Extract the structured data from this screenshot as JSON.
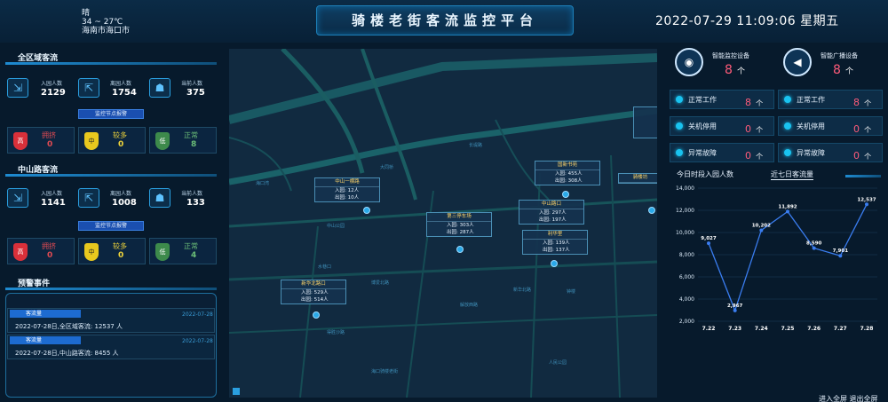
{
  "header": {
    "weather": "晴",
    "temperature": "34 ~ 27℃",
    "location": "海南市海口市",
    "title": "骑楼老街客流监控平台",
    "datetime": "2022-07-29  11:09:06  星期五"
  },
  "area_all": {
    "title": "全区域客流",
    "stats": [
      {
        "label": "入园人数",
        "value": "2129",
        "icon": "enter-icon"
      },
      {
        "label": "离园人数",
        "value": "1754",
        "icon": "exit-icon"
      },
      {
        "label": "当前人数",
        "value": "375",
        "icon": "people-icon"
      }
    ],
    "monitor_label": "监控节点报警",
    "levels": [
      {
        "badge": "高",
        "name": "拥挤",
        "value": "0",
        "color": "#d9303a"
      },
      {
        "badge": "中",
        "name": "较多",
        "value": "0",
        "color": "#e8c81e"
      },
      {
        "badge": "低",
        "name": "正常",
        "value": "8",
        "color": "#3d8a4b"
      }
    ]
  },
  "area_zs": {
    "title": "中山路客流",
    "stats": [
      {
        "label": "入园人数",
        "value": "1141",
        "icon": "enter-icon"
      },
      {
        "label": "离园人数",
        "value": "1008",
        "icon": "exit-icon"
      },
      {
        "label": "当前人数",
        "value": "133",
        "icon": "people-icon"
      }
    ],
    "monitor_label": "监控节点报警",
    "levels": [
      {
        "badge": "高",
        "name": "拥挤",
        "value": "0",
        "color": "#d9303a"
      },
      {
        "badge": "中",
        "name": "较多",
        "value": "0",
        "color": "#e8c81e"
      },
      {
        "badge": "低",
        "name": "正常",
        "value": "4",
        "color": "#3d8a4b"
      }
    ]
  },
  "alerts": {
    "title": "预警事件",
    "items": [
      {
        "tag": "客流量",
        "date": "2022-07-28",
        "text": "2022-07-28日,全区域客流: 12537 人"
      },
      {
        "tag": "客流量",
        "date": "2022-07-28",
        "text": "2022-07-28日,中山路客流: 8455 人"
      }
    ]
  },
  "map": {
    "callouts": [
      {
        "name": "中山一横路",
        "in": "入园: 12人",
        "out": "出园: 10人"
      },
      {
        "name": "第三停车场",
        "in": "入园: 303人",
        "out": "出园: 287人"
      },
      {
        "name": "新华北路口",
        "in": "入园: 529人",
        "out": "出园: 514人"
      },
      {
        "name": "国新书苑",
        "in": "入园: 455人",
        "out": "出园: 308人"
      },
      {
        "name": "中山路口",
        "in": "入园: 297人",
        "out": "出园: 197人"
      },
      {
        "name": "利华里",
        "in": "入园: 139人",
        "out": "出园: 137人"
      },
      {
        "name": "骑楼坊",
        "in": "",
        "out": ""
      }
    ],
    "labels": [
      "长堤路",
      "大同桥",
      "海口湾",
      "中山公园",
      "水巷口",
      "博爱北路",
      "解放西路",
      "新华北路",
      "得胜沙路",
      "钟楼",
      "人民公园",
      "海口骑楼老街"
    ]
  },
  "devices": [
    {
      "label": "智能监控设备",
      "count": "8",
      "unit": "个",
      "icon": "camera-icon"
    },
    {
      "label": "智能广播设备",
      "count": "8",
      "unit": "个",
      "icon": "megaphone-icon"
    }
  ],
  "device_states": [
    {
      "label": "正常工作",
      "value": "8",
      "unit": "个"
    },
    {
      "label": "正常工作",
      "value": "8",
      "unit": "个"
    },
    {
      "label": "关机停用",
      "value": "0",
      "unit": "个"
    },
    {
      "label": "关机停用",
      "value": "0",
      "unit": "个"
    },
    {
      "label": "异常故障",
      "value": "0",
      "unit": "个"
    },
    {
      "label": "异常故障",
      "value": "0",
      "unit": "个"
    }
  ],
  "chart_tabs": {
    "tab1": "今日时段入园人数",
    "tab2": "近七日客流量"
  },
  "footer": {
    "fullscreen": "进入全屏 退出全屏"
  },
  "chart_data": {
    "type": "line",
    "categories": [
      "7.22",
      "7.23",
      "7.24",
      "7.25",
      "7.26",
      "7.27",
      "7.28"
    ],
    "values": [
      9027,
      2967,
      10202,
      11892,
      8590,
      7901,
      12537
    ],
    "ylim": [
      2000,
      14000
    ],
    "yticks": [
      2000,
      4000,
      6000,
      8000,
      10000,
      12000,
      14000
    ],
    "grid": true,
    "color": "#3a7df0"
  }
}
